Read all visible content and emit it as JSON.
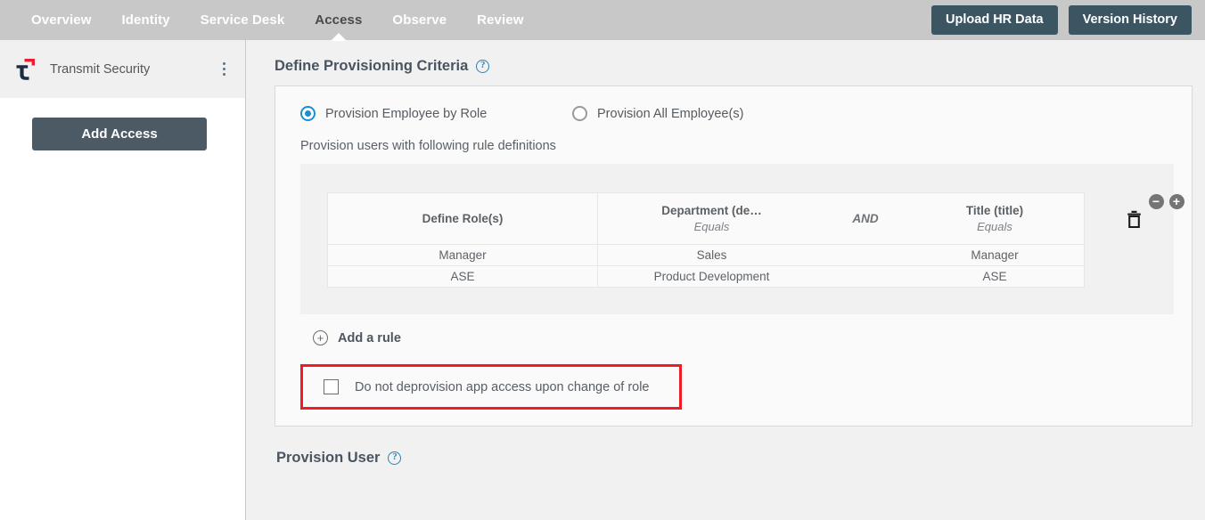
{
  "topnav": {
    "tabs": [
      {
        "label": "Overview",
        "active": false
      },
      {
        "label": "Identity",
        "active": false
      },
      {
        "label": "Service Desk",
        "active": false
      },
      {
        "label": "Access",
        "active": true
      },
      {
        "label": "Observe",
        "active": false
      },
      {
        "label": "Review",
        "active": false
      }
    ],
    "upload_button": "Upload HR Data",
    "version_button": "Version History",
    "background_color": "#c8c8c8",
    "button_color": "#3b5563"
  },
  "sidebar": {
    "logo_icon": "transmit-security-logo",
    "org_name": "Transmit Security",
    "menu_icon": "kebab-menu-icon",
    "add_access_button": "Add Access"
  },
  "main": {
    "section_title": "Define Provisioning Criteria",
    "help_icon": "?",
    "radio_options": [
      {
        "label": "Provision Employee by Role",
        "selected": true
      },
      {
        "label": "Provision All Employee(s)",
        "selected": false
      }
    ],
    "rules_caption": "Provision users with following rule definitions",
    "rule_table": {
      "headers": [
        {
          "title": "Define Role(s)",
          "operator": ""
        },
        {
          "title": "Department (de…",
          "operator": "Equals"
        },
        {
          "title": "AND",
          "operator": ""
        },
        {
          "title": "Title (title)",
          "operator": "Equals"
        }
      ],
      "rows": [
        {
          "role": "Manager",
          "department": "Sales",
          "title": "Manager"
        },
        {
          "role": "ASE",
          "department": "Product Development",
          "title": "ASE"
        }
      ],
      "delete_icon": "trash-icon",
      "remove_row_label": "−",
      "add_row_label": "+"
    },
    "add_rule_label": "Add a rule",
    "add_rule_icon": "plus-circle-icon",
    "deprovision": {
      "label": "Do not deprovision app access upon change of role",
      "checked": false,
      "highlight_color": "#ee1c25"
    },
    "provision_user_title": "Provision User",
    "provision_user_help": "?"
  }
}
